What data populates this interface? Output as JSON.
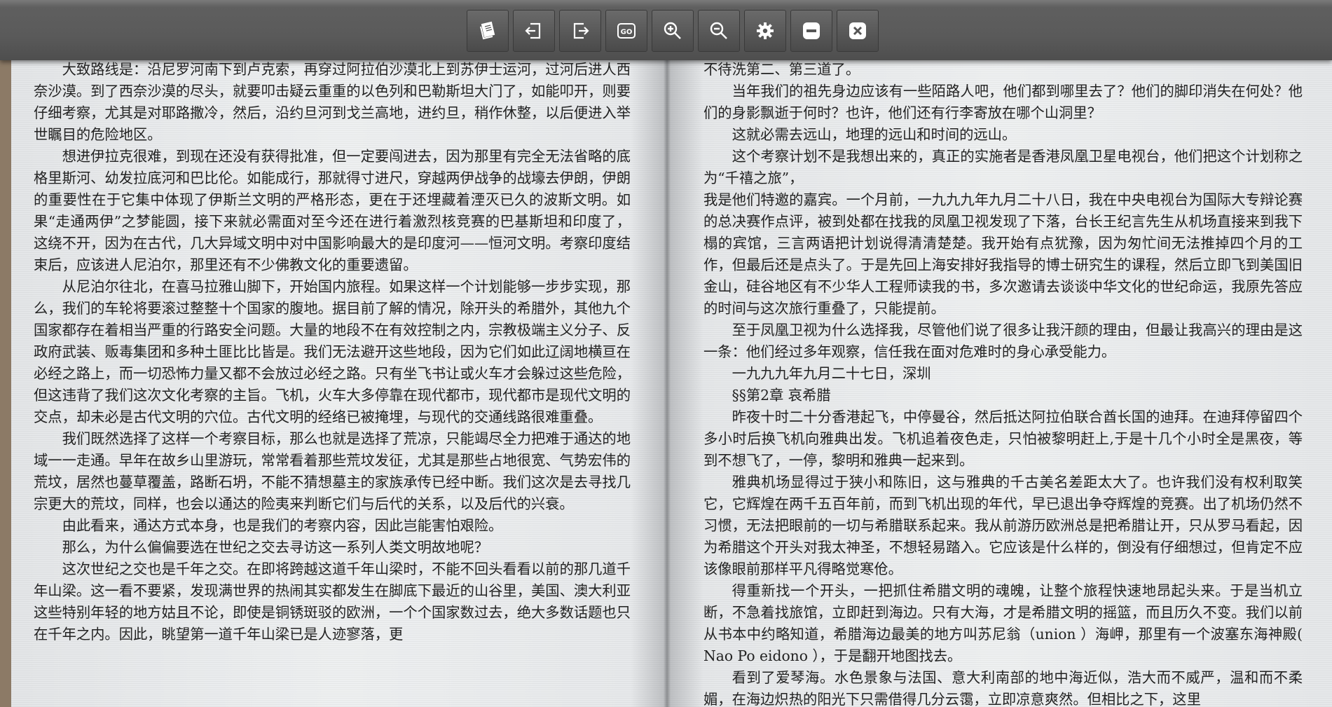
{
  "toolbar": {
    "buttons": [
      {
        "name": "book-contents-icon"
      },
      {
        "name": "previous-page-icon"
      },
      {
        "name": "next-page-icon"
      },
      {
        "name": "go-to-page-icon",
        "label": "GO"
      },
      {
        "name": "zoom-in-icon"
      },
      {
        "name": "zoom-out-icon"
      },
      {
        "name": "settings-gear-icon"
      },
      {
        "name": "minimize-icon"
      },
      {
        "name": "close-icon"
      }
    ]
  },
  "left_page": {
    "paragraphs": [
      "大致路线是：沿尼罗河南下到卢克索，再穿过阿拉伯沙漠北上到苏伊士运河，过河后进人西奈沙漠。到了西奈沙漠的尽头，就要叩击疑云重重的以色列和巴勒斯坦大门了，如能叩开，则要仔细考察，尤其是对耶路撒冷，然后，沿约旦河到戈兰高地，进约旦，稍作休整，以后便进入举世瞩目的危险地区。",
      "想进伊拉克很难，到现在还没有获得批准，但一定要闯进去，因为那里有完全无法省略的底格里斯河、幼发拉底河和巴比伦。如能成行，那就得寸进尺，穿越两伊战争的战壕去伊朗，伊朗的重要性在于它集中体现了伊斯兰文明的严格形态，更在于还埋藏着湮灭已久的波斯文明。如果“走通两伊”之梦能圆，接下来就必需面对至今还在进行着激烈核竞赛的巴基斯坦和印度了，这绕不开，因为在古代，几大异域文明中对中国影响最大的是印度河——恒河文明。考察印度结束后，应该进人尼泊尔，那里还有不少佛教文化的重要遗留。",
      "从尼泊尔往北，在喜马拉雅山脚下，开始国内旅程。如果这样一个计划能够一步步实现，那么，我们的车轮将要滚过整整十个国家的腹地。据目前了解的情况，除开头的希腊外，其他九个国家都存在着相当严重的行路安全问题。大量的地段不在有效控制之内，宗教极端主义分子、反政府武装、贩毒集团和多种土匪比比皆是。我们无法避开这些地段，因为它们如此辽阔地横亘在必经之路上，而一切恐怖力量又都不会放过必经之路。只有坐飞书让或火车才会躲过这些危险，但这违背了我们这次文化考察的主旨。飞机，火车大多停靠在现代都市，现代都市是现代文明的交点，却未必是古代文明的穴位。古代文明的经络已被掩埋，与现代的交通线路很难重叠。",
      "我们既然选择了这样一个考察目标，那么也就是选择了荒凉，只能竭尽全力把难于通达的地域一一走通。早年在故乡山里游玩，常常看着那些荒坟发征，尤其是那些占地很宽、气势宏伟的荒坟，居然也蔓草覆盖，路断石坍，不能不猜想墓主的家族承传已经中断。我们这次是去寻找几宗更大的荒坟，同样，也会以通达的险夷来判断它们与后代的关系，以及后代的兴衰。",
      "由此看来，通达方式本身，也是我们的考察内容，因此岂能害怕艰险。",
      "那么，为什么偏偏要选在世纪之交去寻访这一系列人类文明故地呢？",
      "这次世纪之交也是千年之交。在即将跨越这道千年山梁时，不能不回头看看以前的那几道千年山梁。这一看不要紧，发现满世界的热闹其实都发生在脚底下最近的山谷里，美国、澳大利亚这些特别年轻的地方姑且不论，即使是铜锈斑驳的欧洲，一个个国家数过去，绝大多数话题也只在千年之内。因此，眺望第一道千年山梁已是人迹寥落，更"
    ]
  },
  "right_page": {
    "paragraphs": [
      {
        "text": "不待洗第二、第三道了。",
        "indent": false
      },
      {
        "text": "当年我们的祖先身边应该有一些陌路人吧，他们都到哪里去了？他们的脚印消失在何处？他们的身影飘逝于何时？也许，他们还有行李寄放在哪个山洞里？",
        "indent": true
      },
      {
        "text": "这就必需去远山，地理的远山和时间的远山。",
        "indent": true
      },
      {
        "text": "这个考察计划不是我想出来的，真正的实施者是香港凤凰卫星电视台，他们把这个计划称之为“千禧之旅”，",
        "indent": true
      },
      {
        "text": "我是他们特邀的嘉宾。一个月前，一九九九年九月二十八日，我在中央电视台为国际大专辩论赛的总决赛作点评，被到处都在找我的凤凰卫视发现了下落，台长王纪言先生从机场直接来到我下榻的宾馆，三言两语把计划说得清清楚楚。我开始有点犹豫，因为匆忙间无法推掉四个月的工作，但最后还是点头了。于是先回上海安排好我指导的博士研究生的课程，然后立即飞到美国旧金山，硅谷地区有不少华人工程师读我的书，多次邀请去谈谈中华文化的世纪命运，我原先答应的时间与这次旅行重叠了，只能提前。",
        "indent": false
      },
      {
        "text": "至于凤凰卫视为什么选择我，尽管他们说了很多让我汗颜的理由，但最让我高兴的理由是这一条：他们经过多年观察，信任我在面对危难时的身心承受能力。",
        "indent": true
      },
      {
        "text": "一九九九年九月二十七日，深圳",
        "indent": true
      },
      {
        "text": "§§第2章  哀希腊",
        "indent": true
      },
      {
        "text": "昨夜十时二十分香港起飞，中停曼谷，然后抵达阿拉伯联合酋长国的迪拜。在迪拜停留四个多小时后换飞机向雅典出发。飞机追着夜色走，只怕被黎明赶上,于是十几个小时全是黑夜，等到不想飞了，一停，黎明和雅典一起来到。",
        "indent": true
      },
      {
        "text": "雅典机场显得过于狭小和陈旧，这与雅典的千古美名差距太大了。也许我们没有权利取笑它，它辉煌在两千五百年前，而到飞机出现的年代，早已退出争夺辉煌的竞赛。出了机场仍然不习惯，无法把眼前的一切与希腊联系起来。我从前游历欧洲总是把希腊让开，只从罗马看起，因为希腊这个开头对我太神圣，不想轻易踏入。它应该是什么样的，倒没有仔细想过，但肯定不应该像眼前那样平凡得略觉寒伧。",
        "indent": true
      },
      {
        "text": "得重新找一个开头，一把抓住希腊文明的魂魄，让整个旅程快速地昂起头来。于是当机立断，不急着找旅馆，立即赶到海边。只有大海，才是希腊文明的摇篮，而且历久不变。我们以前从书本中约略知道，希腊海边最美的地方叫苏尼翁（union ）海岬，那里有一个波塞东海神殿( Nao Po eidono ），于是翻开地图找去。",
        "indent": true
      },
      {
        "text": "看到了爱琴海。水色景象与法国、意大利南部的地中海近似，浩大而不威严，温和而不柔媚，在海边炽热的阳光下只需借得几分云霭，立即凉意爽然。但相比之下，这里",
        "indent": true
      }
    ]
  }
}
